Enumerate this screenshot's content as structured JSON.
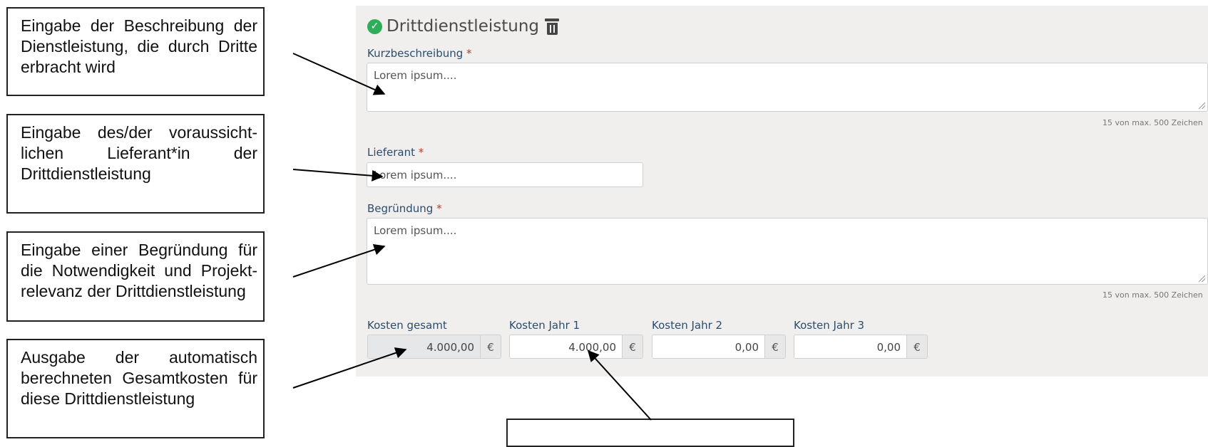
{
  "form": {
    "title": "Drittdienstleistung",
    "kurz": {
      "label": "Kurzbeschreibung",
      "required": "*",
      "value": "Lorem ipsum....",
      "counter": "15 von max. 500 Zeichen"
    },
    "lieferant": {
      "label": "Lieferant",
      "required": "*",
      "value": "Lorem ipsum...."
    },
    "begruendung": {
      "label": "Begründung",
      "required": "*",
      "value": "Lorem ipsum....",
      "counter": "15 von max. 500 Zeichen"
    },
    "costs": [
      {
        "label": "Kosten gesamt",
        "value": "4.000,00",
        "currency": "€"
      },
      {
        "label": "Kosten Jahr 1",
        "value": "4.000,00",
        "currency": "€"
      },
      {
        "label": "Kosten Jahr 2",
        "value": "0,00",
        "currency": "€"
      },
      {
        "label": "Kosten Jahr 3",
        "value": "0,00",
        "currency": "€"
      }
    ]
  },
  "callouts": [
    "Eingabe der Beschreibung der Dienstleistung, die durch Dritte erbracht wird",
    "Eingabe des/der voraussicht-lichen Lieferant*in der Drittdienstleistung",
    "Eingabe einer Begründung für die Notwendigkeit und Projekt-relevanz der Drittdienstleistung",
    "Ausgabe der automatisch berechneten Gesamtkosten für diese Drittdienstleistung",
    ""
  ],
  "icons": {
    "status": "check-circle-icon",
    "delete": "trash-icon"
  },
  "colors": {
    "panel": "#f0efed",
    "check": "#2eae5a",
    "label": "#2a4d6e",
    "required": "#c0392b"
  }
}
